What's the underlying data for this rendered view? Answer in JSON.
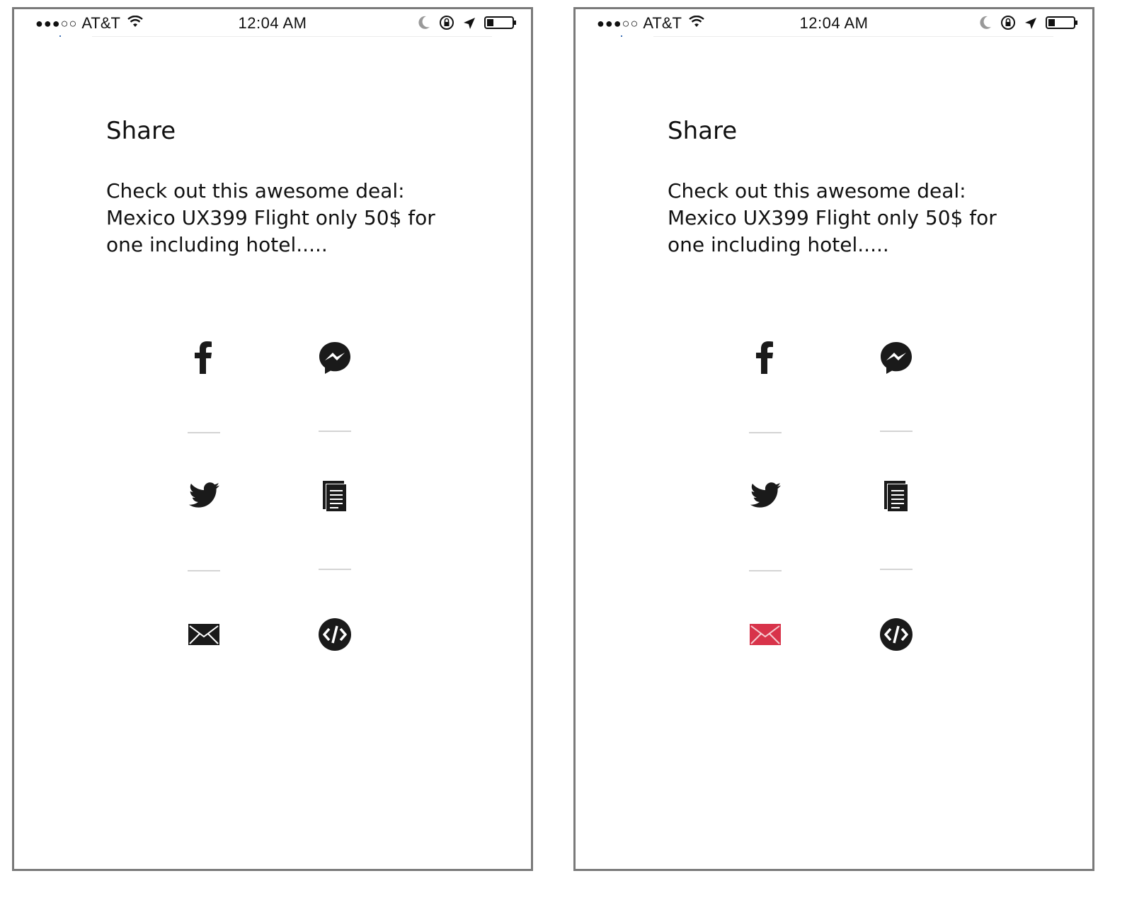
{
  "screens": [
    {
      "status_bar": {
        "carrier": "AT&T",
        "time": "12:04 AM"
      },
      "title": "Share",
      "message": "Check out this awesome deal: Mexico UX399 Flight only 50$ for one including hotel.....",
      "share_options": [
        {
          "icon": "facebook-icon",
          "color": "#1a1a1a"
        },
        {
          "icon": "messenger-icon",
          "color": "#1a1a1a"
        },
        {
          "icon": "twitter-icon",
          "color": "#1a1a1a"
        },
        {
          "icon": "copy-document-icon",
          "color": "#1a1a1a"
        },
        {
          "icon": "mail-icon",
          "color": "#1a1a1a"
        },
        {
          "icon": "embed-code-icon",
          "color": "#1a1a1a"
        }
      ]
    },
    {
      "status_bar": {
        "carrier": "AT&T",
        "time": "12:04 AM"
      },
      "title": "Share",
      "message": "Check out this awesome deal: Mexico UX399 Flight only 50$ for one including hotel.....",
      "share_options": [
        {
          "icon": "facebook-icon",
          "color": "#1a1a1a"
        },
        {
          "icon": "messenger-icon",
          "color": "#1a1a1a"
        },
        {
          "icon": "twitter-icon",
          "color": "#1a1a1a"
        },
        {
          "icon": "copy-document-icon",
          "color": "#1a1a1a"
        },
        {
          "icon": "mail-icon",
          "color": "#d8334a",
          "selected": true
        },
        {
          "icon": "embed-code-icon",
          "color": "#1a1a1a"
        }
      ]
    }
  ]
}
